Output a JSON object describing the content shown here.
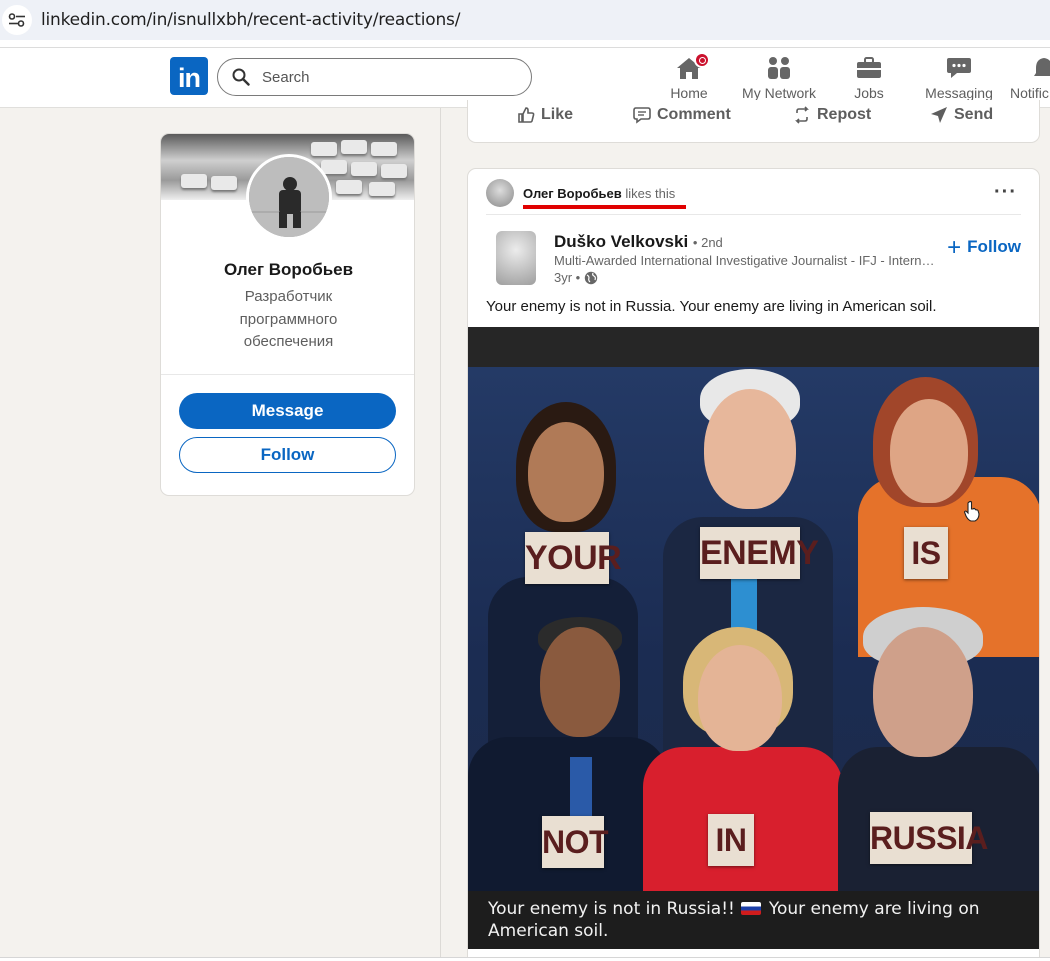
{
  "browser": {
    "url": "linkedin.com/in/isnullxbh/recent-activity/reactions/",
    "site_icon": "site-settings-icon"
  },
  "nav": {
    "logo_text": "in",
    "search_placeholder": "Search",
    "items": [
      {
        "label": "Home",
        "icon": "home-icon"
      },
      {
        "label": "My Network",
        "icon": "network-icon"
      },
      {
        "label": "Jobs",
        "icon": "briefcase-icon"
      },
      {
        "label": "Messaging",
        "icon": "messaging-icon"
      },
      {
        "label": "Notific",
        "icon": "bell-icon"
      }
    ],
    "accent_color": "#0a66c2"
  },
  "profile": {
    "name": "Олег Воробьев",
    "headline": "Разработчик программного обеспечения",
    "message_label": "Message",
    "follow_label": "Follow"
  },
  "previous_post_actions": {
    "like": "Like",
    "comment": "Comment",
    "repost": "Repost",
    "send": "Send"
  },
  "post": {
    "reactor_name": "Олег Воробьев",
    "reaction_text": "likes this",
    "more_label": "···",
    "author_name": "Duško Velkovski",
    "author_degree": "• 2nd",
    "author_headline": "Multi-Awarded International Investigative Journalist - IFJ - International Federation of Journalists",
    "time": "3yr •",
    "follow_label": "Follow",
    "text": "Your enemy is not in Russia. Your enemy are living in American soil.",
    "image": {
      "signs": [
        "YOUR",
        "ENEMY",
        "IS",
        "NOT",
        "IN",
        "RUSSIA"
      ],
      "caption_part1": "Your enemy is not in Russia!!",
      "caption_part2": "Your enemy are living on American soil."
    }
  }
}
